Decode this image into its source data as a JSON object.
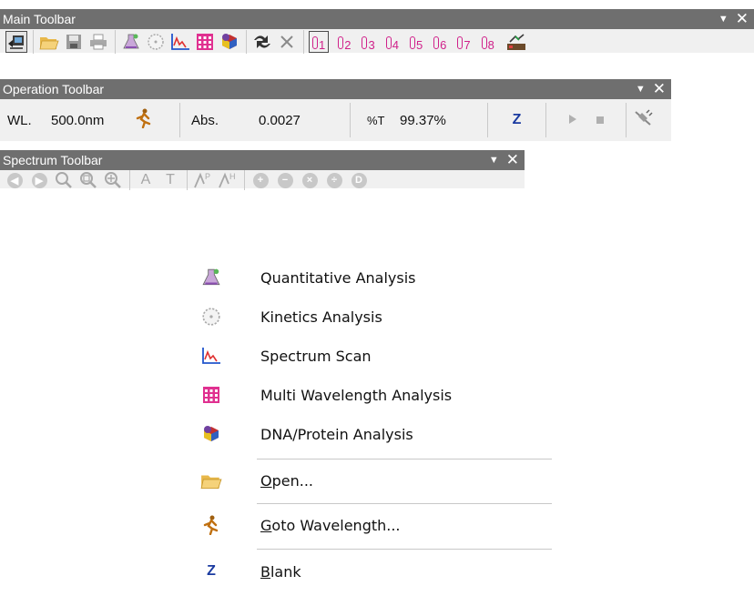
{
  "main_toolbar": {
    "title": "Main Toolbar",
    "buttons": [
      "app-icon",
      "open-folder-icon",
      "save-icon",
      "print-icon",
      "quantitative-flask-icon",
      "kinetics-clock-icon",
      "spectrum-scan-icon",
      "multi-wavelength-grid-icon",
      "dna-protein-icon",
      "settings-arrows-icon",
      "clear-x-icon"
    ],
    "memory_cells": [
      "1",
      "2",
      "3",
      "4",
      "5",
      "6",
      "7",
      "8"
    ],
    "selected_cell": "1",
    "memory_color": "#d0208a"
  },
  "operation_toolbar": {
    "title": "Operation Toolbar",
    "wl_label": "WL.",
    "wl_value": "500.0nm",
    "abs_label": "Abs.",
    "abs_value": "0.0027",
    "t_label": "%T",
    "t_value": "99.37%",
    "blank_label": "Z"
  },
  "spectrum_toolbar": {
    "title": "Spectrum Toolbar",
    "text_a": "A",
    "text_t": "T"
  },
  "context_menu": {
    "items": [
      {
        "label": "Quantitative Analysis",
        "icon": "quantitative-flask-icon"
      },
      {
        "label": "Kinetics Analysis",
        "icon": "kinetics-clock-icon"
      },
      {
        "label": "Spectrum Scan",
        "icon": "spectrum-scan-icon"
      },
      {
        "label": "Multi Wavelength Analysis",
        "icon": "multi-wavelength-grid-icon"
      },
      {
        "label": "DNA/Protein Analysis",
        "icon": "dna-protein-icon"
      }
    ],
    "open_mnemonic": "O",
    "open_rest": "pen...",
    "goto_mnemonic": "G",
    "goto_rest": "oto Wavelength...",
    "blank_mnemonic": "B",
    "blank_rest": "lank",
    "blank_icon_text": "Z"
  }
}
